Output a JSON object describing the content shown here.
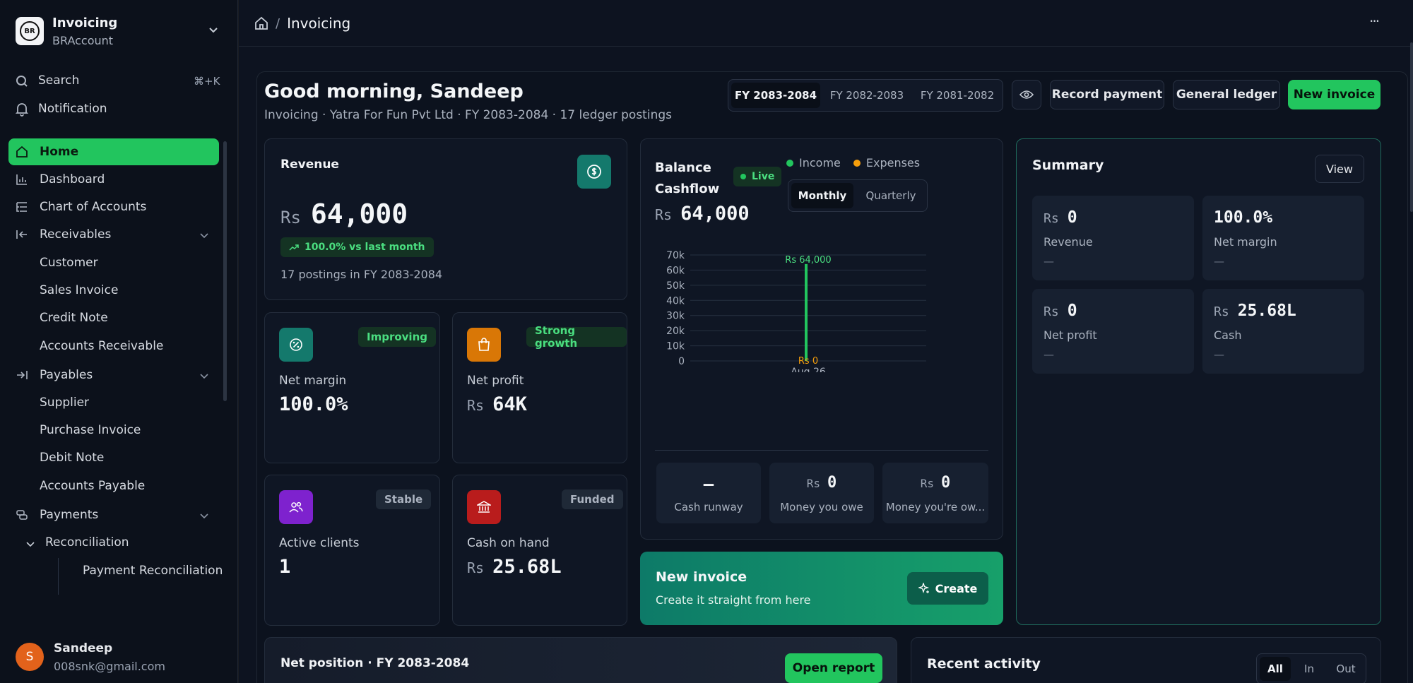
{
  "workspace": {
    "name": "Invoicing",
    "account": "BRAccount",
    "logo_text": "BR"
  },
  "sidebar": {
    "search_label": "Search",
    "search_shortcut": "⌘+K",
    "notification_label": "Notification",
    "items": {
      "home": "Home",
      "dashboard": "Dashboard",
      "chart_of_accounts": "Chart of Accounts",
      "receivables": "Receivables",
      "customer": "Customer",
      "sales_invoice": "Sales Invoice",
      "credit_note": "Credit Note",
      "accounts_receivable": "Accounts Receivable",
      "payables": "Payables",
      "supplier": "Supplier",
      "purchase_invoice": "Purchase Invoice",
      "debit_note": "Debit Note",
      "accounts_payable": "Accounts Payable",
      "payments": "Payments",
      "reconciliation": "Reconciliation",
      "payment_reconciliation": "Payment Reconciliation"
    },
    "user": {
      "initial": "S",
      "name": "Sandeep",
      "email": "008snk@gmail.com"
    }
  },
  "topbar": {
    "breadcrumb_current": "Invoicing",
    "more": "···"
  },
  "header": {
    "greeting": "Good morning, Sandeep",
    "subtitle": "Invoicing · Yatra For Fun Pvt Ltd · FY 2083-2084 · 17 ledger postings",
    "fy_tabs": [
      "FY 2083-2084",
      "FY 2082-2083",
      "FY 2081-2082"
    ],
    "record_payment": "Record payment",
    "general_ledger": "General ledger",
    "new_invoice": "New invoice"
  },
  "revenue": {
    "title": "Revenue",
    "currency": "Rs",
    "amount": "64,000",
    "trend": "100.0% vs last month",
    "postings": "17 postings in FY 2083-2084"
  },
  "kpis": {
    "net_margin": {
      "label": "Net margin",
      "value": "100.0%",
      "badge": "Improving"
    },
    "net_profit": {
      "label": "Net profit",
      "currency": "Rs",
      "value": "64K",
      "badge": "Strong growth"
    },
    "active_clients": {
      "label": "Active clients",
      "value": "1",
      "badge": "Stable"
    },
    "cash_on_hand": {
      "label": "Cash on hand",
      "currency": "Rs",
      "value": "25.68L",
      "badge": "Funded"
    }
  },
  "cashflow": {
    "title_line1": "Balance",
    "title_line2": "Cashflow",
    "live": "Live",
    "legend_income": "Income",
    "legend_expenses": "Expenses",
    "toggle": [
      "Monthly",
      "Quarterly"
    ],
    "currency": "Rs",
    "amount": "64,000",
    "stats": {
      "runway_value": "–",
      "runway_label": "Cash runway",
      "owe_currency": "Rs",
      "owe_value": "0",
      "owe_label": "Money you owe",
      "owed_currency": "Rs",
      "owed_value": "0",
      "owed_label": "Money you're ow..."
    }
  },
  "chart_data": {
    "type": "bar",
    "categories": [
      "Aug 26"
    ],
    "series": [
      {
        "name": "Income",
        "values": [
          64000
        ],
        "label": "Rs 64,000",
        "color": "#22c55e"
      },
      {
        "name": "Expenses",
        "values": [
          0
        ],
        "label": "Rs 0",
        "color": "#f59e0b"
      }
    ],
    "yticks": [
      "70k",
      "60k",
      "50k",
      "40k",
      "30k",
      "20k",
      "10k",
      "0"
    ],
    "ylim": [
      0,
      70000
    ],
    "grid": true
  },
  "new_invoice_cta": {
    "title": "New invoice",
    "subtitle": "Create it straight from here",
    "button": "Create"
  },
  "summary": {
    "title": "Summary",
    "view": "View",
    "tiles": {
      "revenue": {
        "currency": "Rs",
        "value": "0",
        "label": "Revenue",
        "sub": "—"
      },
      "net_margin": {
        "value": "100.0%",
        "label": "Net margin",
        "sub": "—"
      },
      "net_profit": {
        "currency": "Rs",
        "value": "0",
        "label": "Net profit",
        "sub": "—"
      },
      "cash": {
        "currency": "Rs",
        "value": "25.68L",
        "label": "Cash",
        "sub": "—"
      }
    }
  },
  "net_position": {
    "title": "Net position · FY 2083-2084",
    "button": "Open report"
  },
  "recent_activity": {
    "title": "Recent activity",
    "filters": [
      "All",
      "In",
      "Out"
    ]
  },
  "colors": {
    "accent": "#22c55e",
    "teal": "#14796c",
    "orange": "#d97706",
    "purple": "#7e22ce",
    "red": "#b91c1c"
  }
}
